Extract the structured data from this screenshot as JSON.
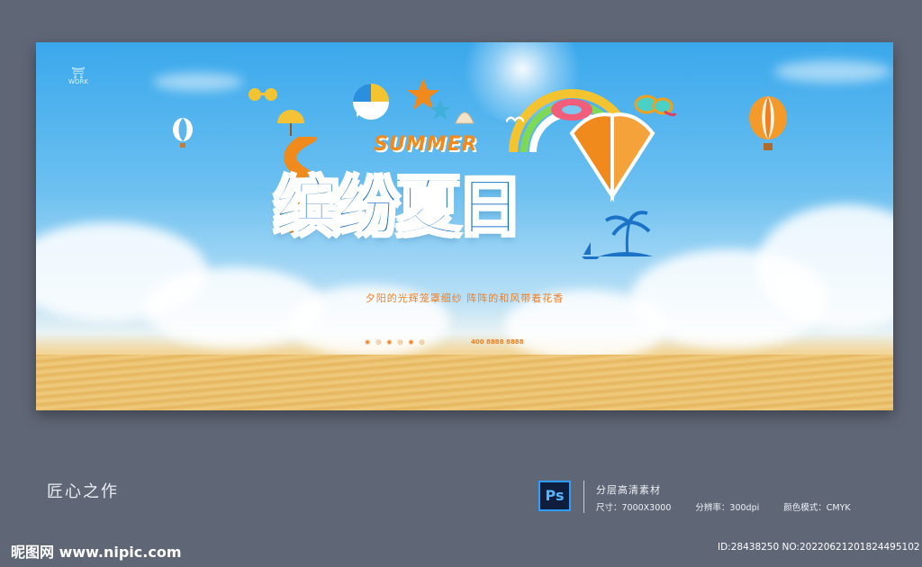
{
  "poster": {
    "work_logo_mark": "WORK",
    "summer": "SUMMER",
    "main_title": "缤纷夏日",
    "slogan": "夕阳的光辉笼罩细纱  阵阵的和风带着花香",
    "phone": "400 8888 8888"
  },
  "footer": {
    "brand_name": "匠心之作",
    "ps_label": "Ps",
    "info_title": "分层高清素材",
    "size_label": "尺寸：7000X3000",
    "dpi_label": "分辨率：300dpi",
    "color_mode_label": "颜色模式：CMYK",
    "site": "昵图网 www.nipic.com",
    "id_text": "ID:28438250 NO:20220621201824495102"
  },
  "colors": {
    "sky_top": "#3aa8ec",
    "title_blue": "#1c73c6",
    "accent_orange": "#f08a1c",
    "frame_gray": "#5f6676"
  }
}
